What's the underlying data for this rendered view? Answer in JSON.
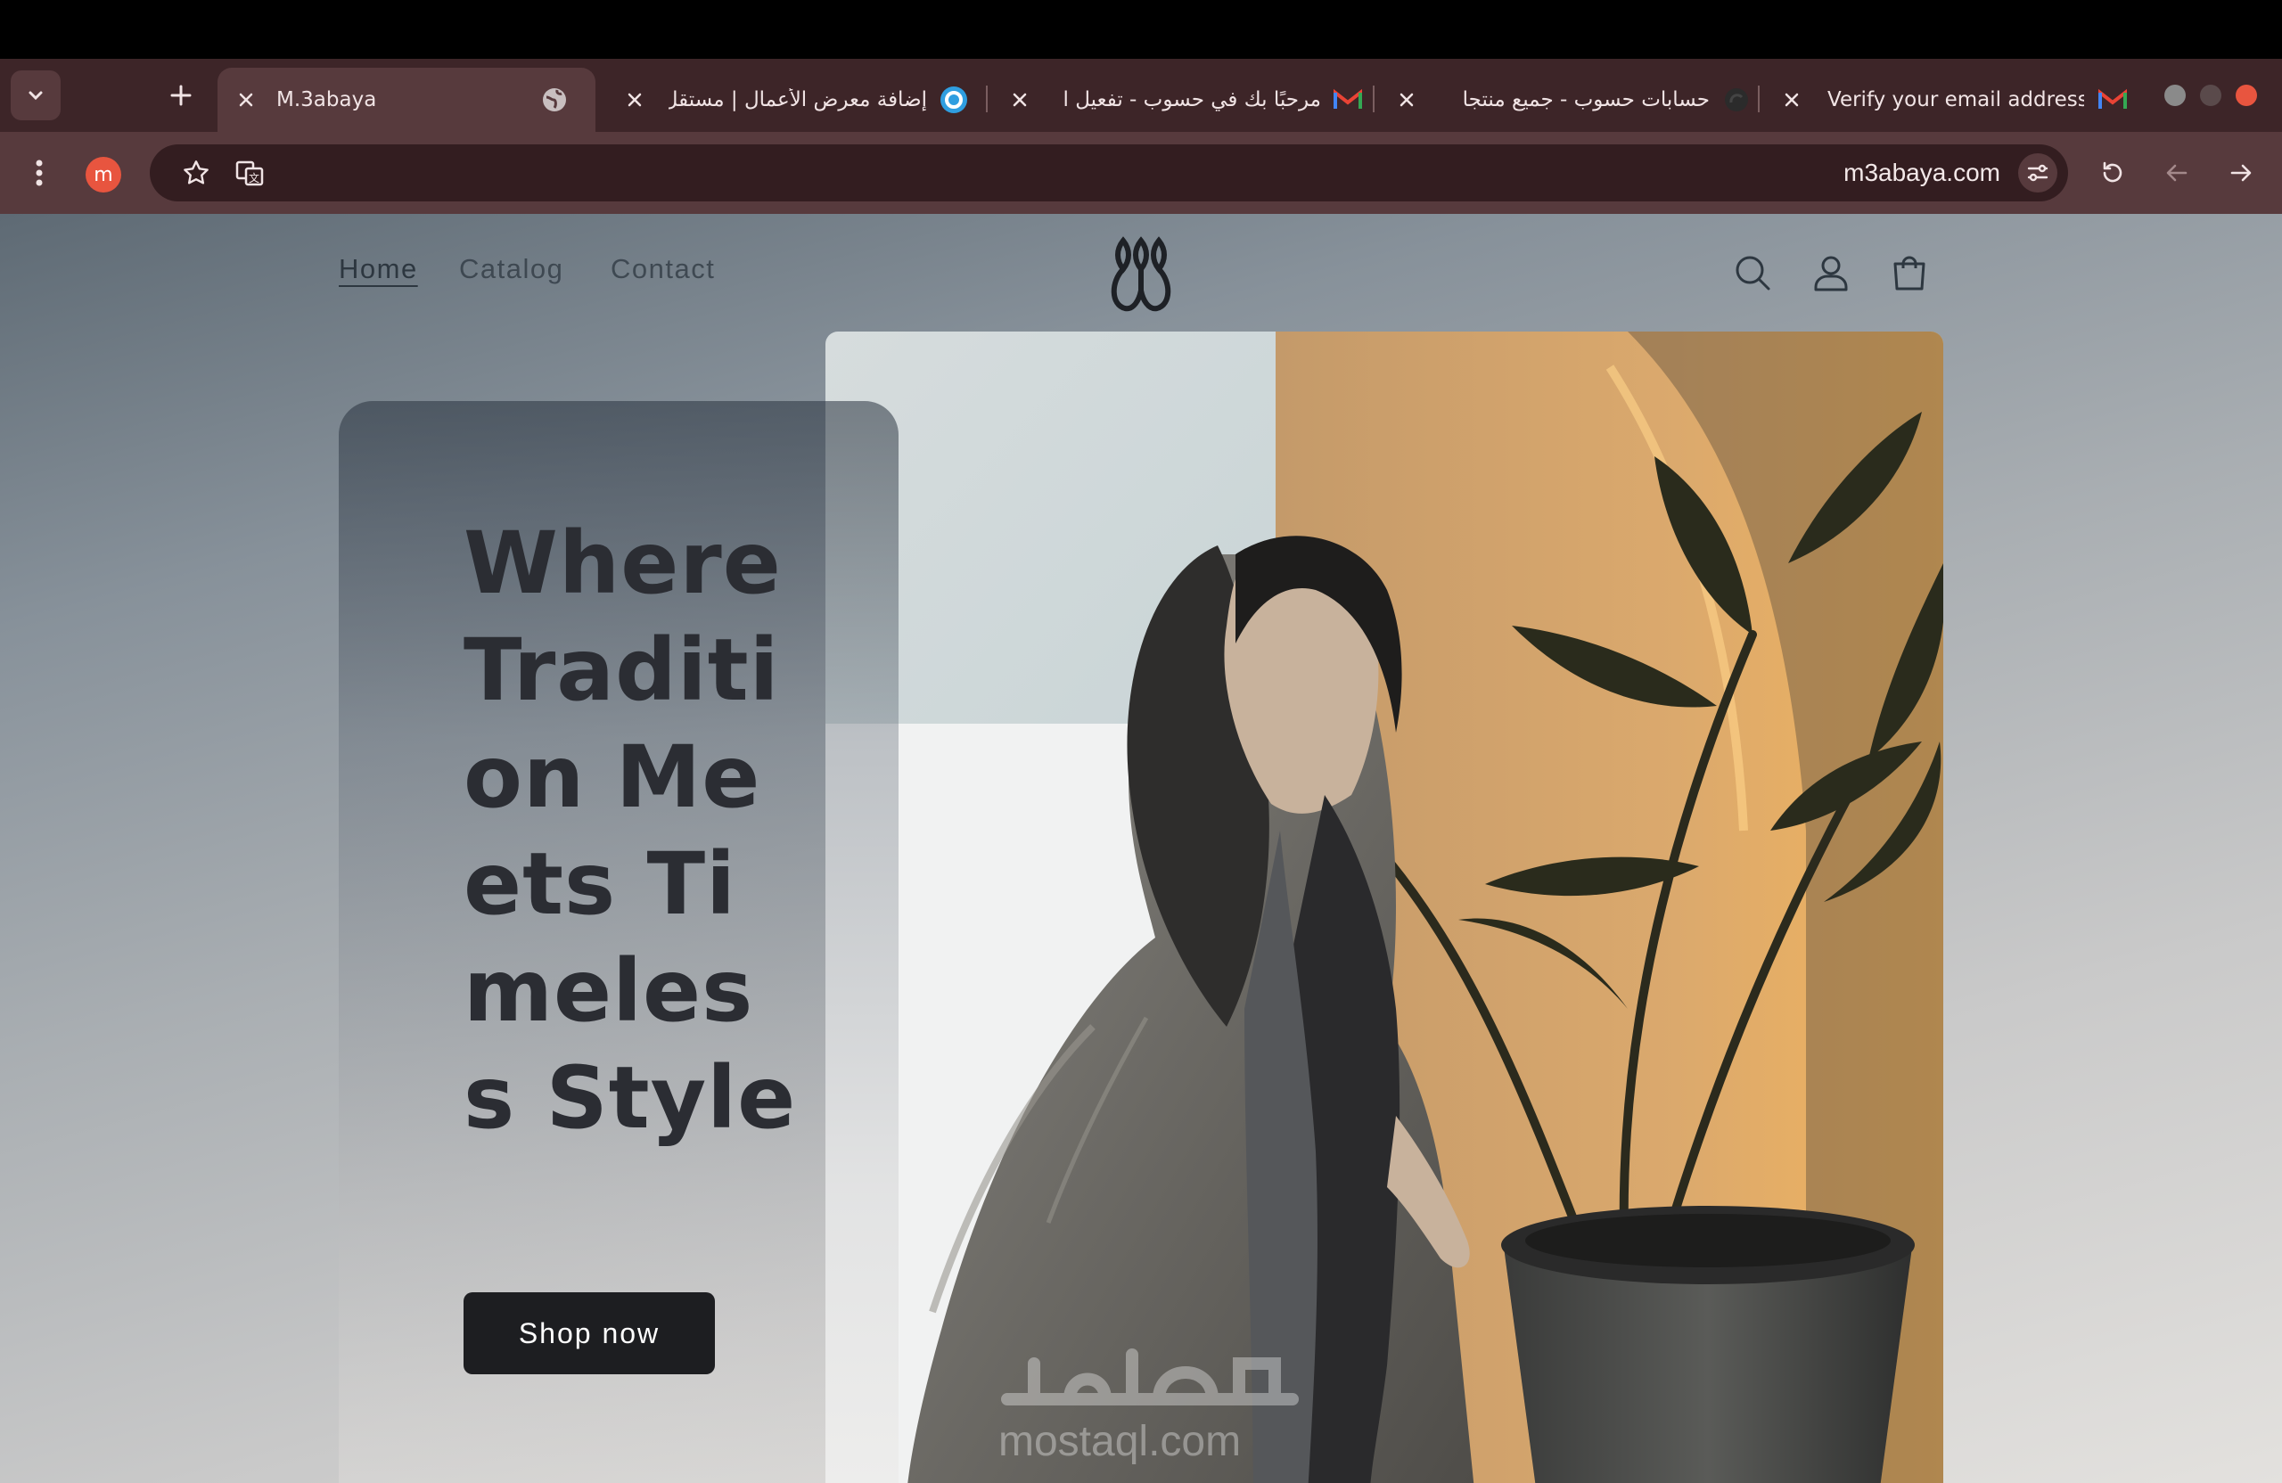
{
  "browser": {
    "tabs": [
      {
        "title": "M.3abaya",
        "favicon": "globe-icon",
        "active": true
      },
      {
        "title": "إضافة معرض الأعمال | مستقل",
        "favicon": "mostaql-icon",
        "active": false
      },
      {
        "title": "مرحبًا بك في حسوب - تفعيل ال",
        "favicon": "gmail-icon",
        "active": false
      },
      {
        "title": "حسابات حسوب - جميع منتجا",
        "favicon": "hsoub-icon",
        "active": false
      },
      {
        "title": "Verify your email address",
        "favicon": "gmail-icon",
        "active": false
      }
    ],
    "profile_initial": "m",
    "url": "m3abaya.com",
    "colors": {
      "tabstrip": "#3d2528",
      "toolbar": "#573a3d",
      "omnibox": "#331d20",
      "avatar": "#e8553f"
    }
  },
  "site": {
    "nav": [
      {
        "label": "Home",
        "current": true
      },
      {
        "label": "Catalog",
        "current": false
      },
      {
        "label": "Contact",
        "current": false
      }
    ],
    "header_icons": [
      "search-icon",
      "account-icon",
      "cart-icon"
    ],
    "hero": {
      "title": "Where Tradition Meets Timeless Style",
      "cta": "Shop now"
    },
    "watermark": {
      "text_latin": "mostaql.com"
    }
  }
}
